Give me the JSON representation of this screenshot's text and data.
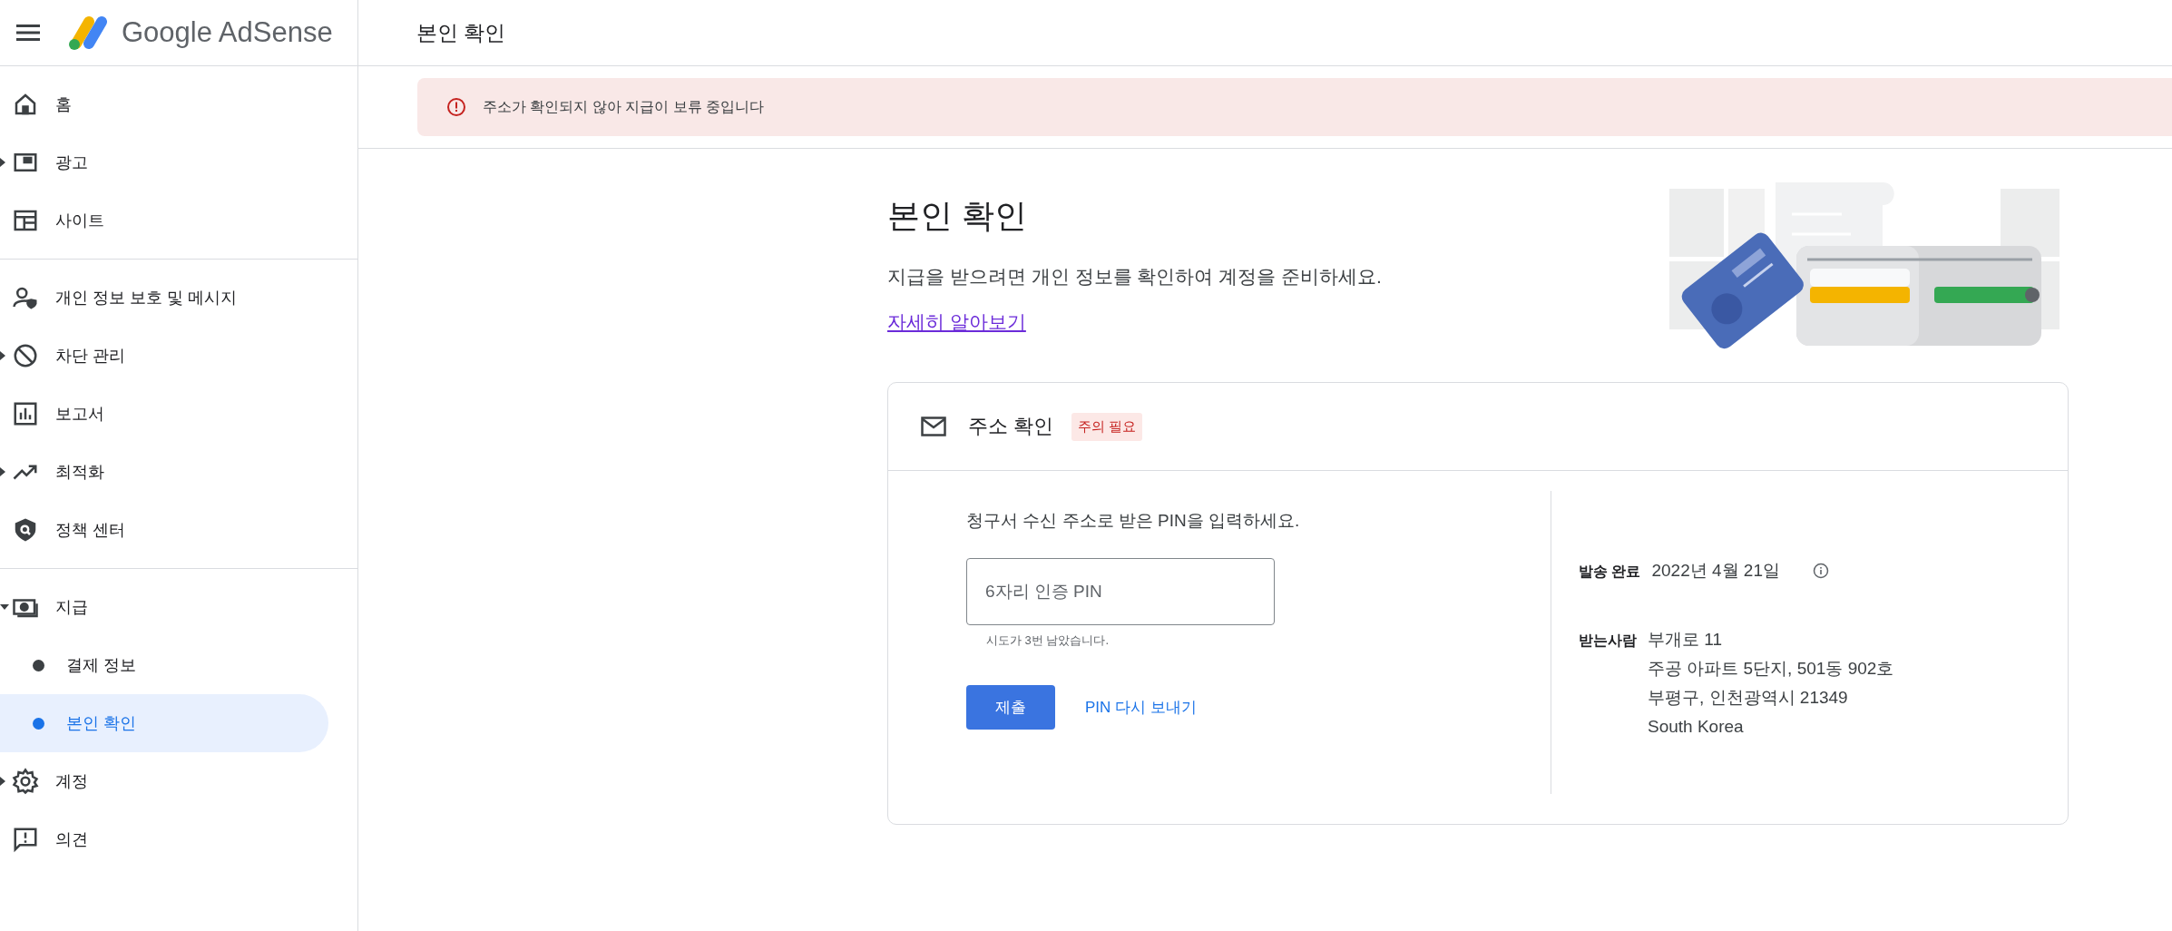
{
  "header": {
    "brand": "Google AdSense",
    "page_title": "본인 확인"
  },
  "sidebar": {
    "sections": [
      [
        {
          "kind": "link",
          "label": "홈",
          "selected": false
        },
        {
          "kind": "group",
          "label": "광고",
          "expanded": false,
          "selected": false
        },
        {
          "kind": "link",
          "label": "사이트",
          "selected": false
        }
      ],
      [
        {
          "kind": "link",
          "label": "개인 정보 보호 및 메시지",
          "selected": false
        },
        {
          "kind": "group",
          "label": "차단 관리",
          "expanded": false,
          "selected": false
        },
        {
          "kind": "link",
          "label": "보고서",
          "selected": false
        },
        {
          "kind": "group",
          "label": "최적화",
          "expanded": false,
          "selected": false
        },
        {
          "kind": "link",
          "label": "정책 센터",
          "selected": false
        }
      ],
      [
        {
          "kind": "group",
          "label": "지급",
          "expanded": true,
          "selected": false
        },
        {
          "kind": "sub",
          "label": "결제 정보",
          "selected": false
        },
        {
          "kind": "sub",
          "label": "본인 확인",
          "selected": true
        },
        {
          "kind": "group",
          "label": "계정",
          "expanded": false,
          "selected": false
        },
        {
          "kind": "link",
          "label": "의견",
          "selected": false
        }
      ]
    ]
  },
  "alert": {
    "text": "주소가 확인되지 않아 지급이 보류 중입니다"
  },
  "intro": {
    "title": "본인 확인",
    "description": "지급을 받으려면 개인 정보를 확인하여 계정을 준비하세요.",
    "link": "자세히 알아보기"
  },
  "card": {
    "title": "주소 확인",
    "badge": "주의 필요",
    "instruction": "청구서 수신 주소로 받은 PIN을 입력하세요.",
    "pin_field": {
      "placeholder": "6자리 인증 PIN",
      "hint": "시도가 3번 남았습니다."
    },
    "submit": "제출",
    "resend": "PIN 다시 보내기",
    "sent_label": "발송 완료",
    "sent_date": "2022년 4월 21일",
    "recipient_label": "받는사람",
    "address_lines": [
      "부개로 11",
      "주공 아파트 5단지, 501동 902호",
      "부평구, 인천광역시 21349",
      "South Korea"
    ]
  }
}
